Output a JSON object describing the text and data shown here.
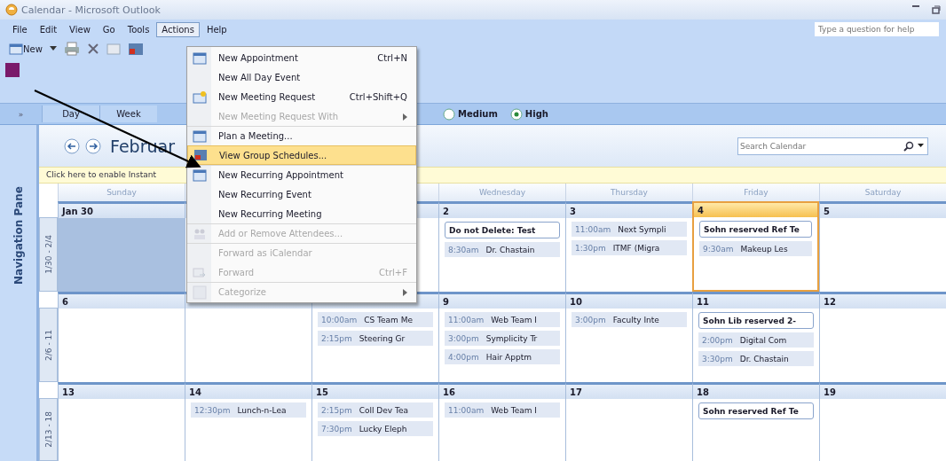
{
  "window": {
    "title": "Calendar - Microsoft Outlook"
  },
  "menubar": [
    {
      "label": "File",
      "selected": false
    },
    {
      "label": "Edit",
      "selected": false
    },
    {
      "label": "View",
      "selected": false
    },
    {
      "label": "Go",
      "selected": false
    },
    {
      "label": "Tools",
      "selected": false
    },
    {
      "label": "Actions",
      "selected": true
    },
    {
      "label": "Help",
      "selected": false
    }
  ],
  "help_box": {
    "placeholder": "Type a question for help"
  },
  "toolbar": {
    "new_button": "New"
  },
  "view_tabs": [
    {
      "label": "Day"
    },
    {
      "label": "Week"
    }
  ],
  "detail_options": [
    {
      "label": "Medium",
      "selected": false
    },
    {
      "label": "High",
      "selected": true
    }
  ],
  "nav_pane": {
    "expand": "»",
    "label": "Navigation Pane"
  },
  "calendar": {
    "title": "Februar",
    "search": {
      "placeholder": "Search Calendar"
    },
    "info_bar": "Click here to enable Instant",
    "days": [
      {
        "label": "Sunday"
      },
      {
        "label": "Wednesday"
      },
      {
        "label": "Thursday"
      },
      {
        "label": "Friday"
      },
      {
        "label": "Saturday"
      }
    ],
    "weeks": [
      {
        "range": "1/30 - 2/4",
        "cells": [
          {
            "date": "Jan 30",
            "selected": true,
            "today": false
          },
          {
            "selected": false,
            "today": false
          },
          {
            "selected": false,
            "today": false
          },
          {
            "date": "2",
            "selected": false,
            "today": false,
            "events": [
              {
                "kind": "allday",
                "title": "Do not Delete: Test"
              },
              {
                "kind": "timed",
                "time": "8:30am",
                "title": "Dr. Chastain"
              }
            ]
          },
          {
            "date": "3",
            "selected": false,
            "today": false,
            "events": [
              {
                "kind": "timed",
                "time": "11:00am",
                "title": "Next Sympli"
              },
              {
                "kind": "timed",
                "time": "1:30pm",
                "title": "ITMF (Migra"
              }
            ]
          },
          {
            "date": "4",
            "selected": false,
            "today": true,
            "events": [
              {
                "kind": "allday",
                "title": "Sohn reserved Ref Te"
              },
              {
                "kind": "timed",
                "time": "9:30am",
                "title": "Makeup Les"
              }
            ]
          },
          {
            "date": "5",
            "selected": false,
            "today": false
          }
        ]
      },
      {
        "range": "2/6 - 11",
        "cells": [
          {
            "date": "6",
            "selected": false,
            "today": false
          },
          {
            "selected": false,
            "today": false
          },
          {
            "selected": false,
            "today": false,
            "events": [
              {
                "kind": "timed",
                "time": "10:00am",
                "title": "CS Team Me"
              },
              {
                "kind": "timed",
                "time": "2:15pm",
                "title": "Steering Gr"
              }
            ]
          },
          {
            "date": "9",
            "selected": false,
            "today": false,
            "events": [
              {
                "kind": "timed",
                "time": "11:00am",
                "title": "Web Team I"
              },
              {
                "kind": "timed",
                "time": "3:00pm",
                "title": "Symplicity Tr"
              },
              {
                "kind": "timed",
                "time": "4:00pm",
                "title": "Hair Apptm"
              }
            ]
          },
          {
            "date": "10",
            "selected": false,
            "today": false,
            "events": [
              {
                "kind": "timed",
                "time": "3:00pm",
                "title": "Faculty Inte"
              }
            ]
          },
          {
            "date": "11",
            "selected": false,
            "today": false,
            "events": [
              {
                "kind": "allday",
                "title": "Sohn Lib reserved 2-"
              },
              {
                "kind": "timed",
                "time": "2:00pm",
                "title": "Digital Com"
              },
              {
                "kind": "timed",
                "time": "3:30pm",
                "title": "Dr. Chastain"
              }
            ]
          },
          {
            "date": "12",
            "selected": false,
            "today": false
          }
        ]
      },
      {
        "range": "2/13 - 18",
        "cells": [
          {
            "date": "13",
            "selected": false,
            "today": false
          },
          {
            "date": "14",
            "selected": false,
            "today": false,
            "events": [
              {
                "kind": "timed",
                "time": "12:30pm",
                "title": "Lunch-n-Lea"
              }
            ]
          },
          {
            "date": "15",
            "selected": false,
            "today": false,
            "events": [
              {
                "kind": "timed",
                "time": "2:15pm",
                "title": "Coll Dev Tea"
              },
              {
                "kind": "timed",
                "time": "7:30pm",
                "title": "Lucky Eleph"
              }
            ]
          },
          {
            "date": "16",
            "selected": false,
            "today": false,
            "events": [
              {
                "kind": "timed",
                "time": "11:00am",
                "title": "Web Team I"
              }
            ]
          },
          {
            "date": "17",
            "selected": false,
            "today": false
          },
          {
            "date": "18",
            "selected": false,
            "today": false,
            "events": [
              {
                "kind": "allday",
                "title": "Sohn reserved Ref Te"
              }
            ]
          },
          {
            "date": "19",
            "selected": false,
            "today": false
          }
        ]
      }
    ]
  },
  "actions_menu": [
    {
      "label": "New Appointment",
      "shortcut": "Ctrl+N",
      "disabled": false,
      "selected": false,
      "submenu": false,
      "separator_before": false
    },
    {
      "label": "New All Day Event",
      "disabled": false,
      "selected": false,
      "submenu": false,
      "separator_before": false
    },
    {
      "label": "New Meeting Request",
      "shortcut": "Ctrl+Shift+Q",
      "disabled": false,
      "selected": false,
      "submenu": false,
      "separator_before": false
    },
    {
      "label": "New Meeting Request With",
      "disabled": true,
      "selected": false,
      "submenu": true,
      "separator_before": false
    },
    {
      "label": "Plan a Meeting...",
      "disabled": false,
      "selected": false,
      "submenu": false,
      "separator_before": true
    },
    {
      "label": "View Group Schedules...",
      "disabled": false,
      "selected": true,
      "submenu": false,
      "separator_before": false
    },
    {
      "label": "New Recurring Appointment",
      "disabled": false,
      "selected": false,
      "submenu": false,
      "separator_before": true
    },
    {
      "label": "New Recurring Event",
      "disabled": false,
      "selected": false,
      "submenu": false,
      "separator_before": false
    },
    {
      "label": "New Recurring Meeting",
      "disabled": false,
      "selected": false,
      "submenu": false,
      "separator_before": false
    },
    {
      "label": "Add or Remove Attendees...",
      "disabled": true,
      "selected": false,
      "submenu": false,
      "separator_before": true
    },
    {
      "label": "Forward as iCalendar",
      "disabled": true,
      "selected": false,
      "submenu": false,
      "separator_before": true
    },
    {
      "label": "Forward",
      "shortcut": "Ctrl+F",
      "disabled": true,
      "selected": false,
      "submenu": false,
      "separator_before": false
    },
    {
      "label": "Categorize",
      "disabled": true,
      "selected": false,
      "submenu": true,
      "separator_before": true
    }
  ]
}
